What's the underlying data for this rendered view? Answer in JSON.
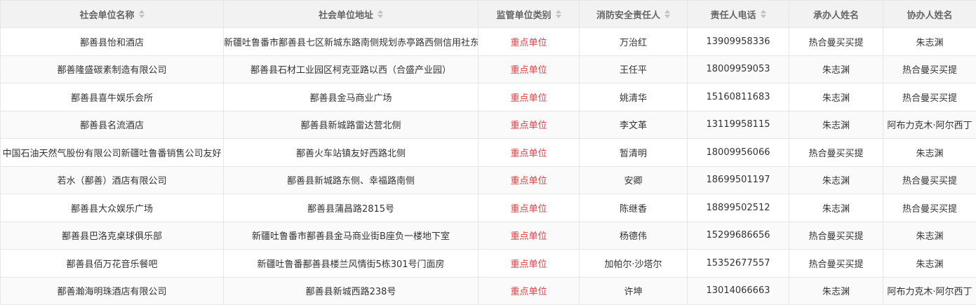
{
  "headers": [
    {
      "label": "社会单位名称",
      "sortable": true
    },
    {
      "label": "社会单位地址",
      "sortable": true
    },
    {
      "label": "监管单位类别",
      "sortable": true
    },
    {
      "label": "消防安全责任人",
      "sortable": true
    },
    {
      "label": "责任人电话",
      "sortable": true
    },
    {
      "label": "承办人姓名",
      "sortable": false
    },
    {
      "label": "协办人姓名",
      "sortable": false
    }
  ],
  "colors": {
    "category": "#e0393e",
    "header_bg": "#f2f2f2",
    "border": "#e6e6e6"
  },
  "icons": {
    "sort": "sort-caret-icon"
  },
  "rows": [
    [
      "鄯善县怡和酒店",
      "新疆吐鲁番市鄯善县七区新城东路南侧规划赤亭路西侧信用社东",
      "重点单位",
      "万治红",
      "13909958336",
      "热合曼买买提",
      "朱志渊"
    ],
    [
      "鄯善隆盛碳素制造有限公司",
      "鄯善县石材工业园区柯克亚路以西（合盛产业园）",
      "重点单位",
      "王任平",
      "18009959053",
      "朱志渊",
      "热合曼买买提"
    ],
    [
      "鄯善县喜牛娱乐会所",
      "鄯善县金马商业广场",
      "重点单位",
      "姚清华",
      "15160811683",
      "朱志渊",
      "热合曼买买提"
    ],
    [
      "鄯善县名流酒店",
      "鄯善县新城路雷达营北侧",
      "重点单位",
      "李文革",
      "13119958115",
      "朱志渊",
      "阿布力克木·阿尔西丁"
    ],
    [
      "中国石油天然气股份有限公司新疆吐鲁番销售公司友好",
      "鄯善火车站镇友好西路北侧",
      "重点单位",
      "暂清明",
      "18009956066",
      "热合曼买买提",
      "朱志渊"
    ],
    [
      "若水（鄯善）酒店有限公司",
      "鄯善县新城路东侧、幸福路南侧",
      "重点单位",
      "安卿",
      "18699501197",
      "朱志渊",
      "热合曼买买提"
    ],
    [
      "鄯善县大众娱乐广场",
      "鄯善县蒲昌路2815号",
      "重点单位",
      "陈继香",
      "18899502512",
      "朱志渊",
      "热合曼买买提"
    ],
    [
      "鄯善县巴洛克桌球俱乐部",
      "新疆吐鲁番市鄯善县金马商业街B座负一楼地下室",
      "重点单位",
      "杨德伟",
      "15299686656",
      "热合曼买买提",
      "朱志渊"
    ],
    [
      "鄯善县佰万花音乐餐吧",
      "新疆吐鲁番鄯善县楼兰风情街5栋301号门面房",
      "重点单位",
      "加帕尔·沙塔尔",
      "15352677557",
      "热合曼买买提",
      "朱志渊"
    ],
    [
      "鄯善瀚海明珠酒店有限公司",
      "鄯善县新城西路238号",
      "重点单位",
      "许坤",
      "13014066663",
      "朱志渊",
      "阿布力克木·阿尔西丁"
    ]
  ]
}
